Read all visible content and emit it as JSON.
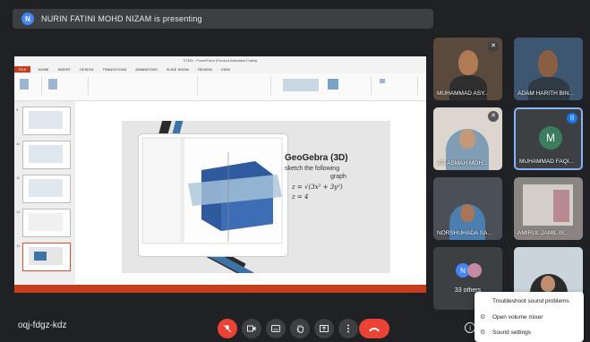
{
  "banner": {
    "avatar_letter": "N",
    "text": "NURIN FATINI MOHD NIZAM is presenting"
  },
  "presentation": {
    "window_title": "STEM - PowerPoint (Product Activation Failed)",
    "menu": [
      "FILE",
      "HOME",
      "INSERT",
      "DESIGN",
      "TRANSITIONS",
      "ANIMATIONS",
      "SLIDE SHOW",
      "REVIEW",
      "VIEW"
    ],
    "slide_numbers": [
      "9",
      "10",
      "11",
      "12",
      "13"
    ],
    "slide": {
      "title": "GeoGebra (3D)",
      "line1": "sketch the following",
      "line2": "graph",
      "eq1": "z = √(3x² + 3y²)",
      "eq2": "z = 4"
    }
  },
  "participants": [
    {
      "name": "MUHAMMAD ASY...",
      "muted": true
    },
    {
      "name": "ADAM HARITH BIN..."
    },
    {
      "name": "ATI ASMAH MOH...",
      "muted": true
    },
    {
      "name": "MUHAMMAD FAQI...",
      "avatar_letter": "M"
    },
    {
      "name": "NORSHUHADA SA..."
    },
    {
      "name": "AMIRUL JAMIL IS..."
    }
  ],
  "others": {
    "avatar_letter": "N",
    "label": "33 others"
  },
  "meeting_code": "oqj-fdgz-kdz",
  "controls": [
    "mic-off-icon",
    "camera-icon",
    "captions-icon",
    "raise-hand-icon",
    "present-icon",
    "more-icon",
    "end-call-icon"
  ],
  "menu": {
    "items": [
      {
        "icon": "",
        "label": "Troubleshoot sound problems"
      },
      {
        "icon": "volume-icon",
        "label": "Open volume mixer"
      },
      {
        "icon": "gear-icon",
        "label": "Sound settings"
      }
    ]
  },
  "colors": {
    "accent_yellow": "#f7c51e",
    "end_call_red": "#ea4335",
    "ppt_orange": "#c43e1c"
  }
}
